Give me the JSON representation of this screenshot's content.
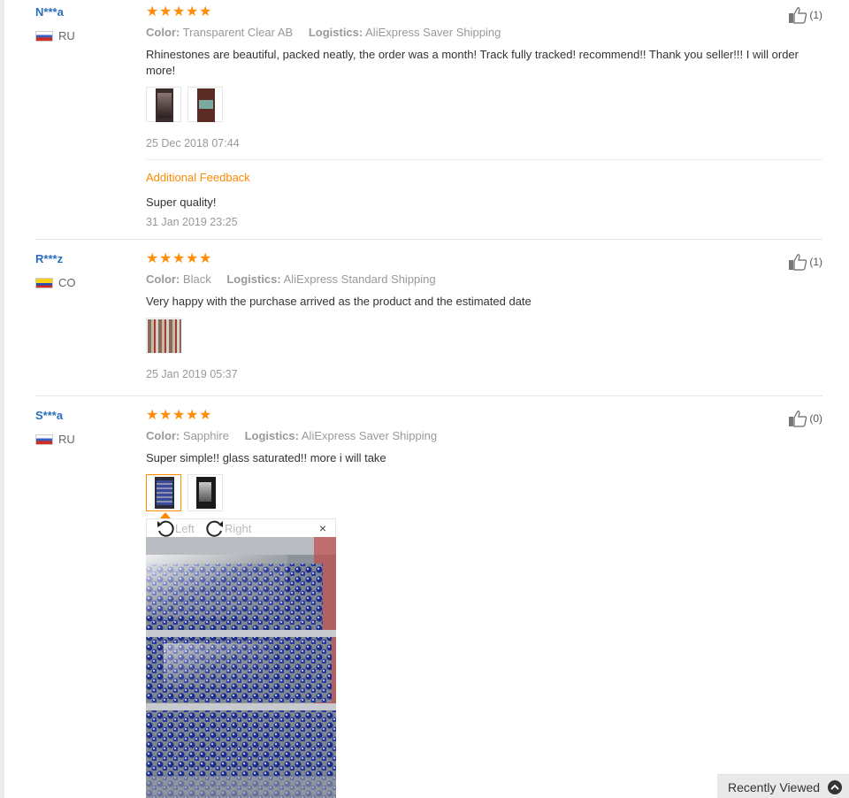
{
  "reviews": [
    {
      "user": "N***a",
      "country": "RU",
      "flag": "ru",
      "rating": 5,
      "color_label": "Color:",
      "color_value": "Transparent Clear AB",
      "logistics_label": "Logistics:",
      "logistics_value": "AliExpress Saver Shipping",
      "text": "Rhinestones are beautiful, packed neatly, the order was a month! Track fully tracked! recommend!! Thank you seller!!! I will order more!",
      "date": "25 Dec 2018 07:44",
      "additional_feedback_label": "Additional Feedback",
      "additional_text": "Super quality!",
      "additional_date": "31 Jan 2019 23:25",
      "helpful_count": "(1)"
    },
    {
      "user": "R***z",
      "country": "CO",
      "flag": "co",
      "rating": 5,
      "color_label": "Color:",
      "color_value": "Black",
      "logistics_label": "Logistics:",
      "logistics_value": "AliExpress Standard Shipping",
      "text": "Very happy with the purchase arrived as the product and the estimated date",
      "date": "25 Jan 2019 05:37",
      "helpful_count": "(1)"
    },
    {
      "user": "S***a",
      "country": "RU",
      "flag": "ru",
      "rating": 5,
      "color_label": "Color:",
      "color_value": "Sapphire",
      "logistics_label": "Logistics:",
      "logistics_value": "AliExpress Saver Shipping",
      "text": "Super simple!! glass saturated!! more i will take",
      "helpful_count": "(0)"
    }
  ],
  "viewer": {
    "rotate_left": "Left",
    "rotate_right": "Right",
    "close": "×"
  },
  "recently_viewed": "Recently Viewed",
  "colors": {
    "accent": "#ff8a00",
    "star": "#ff8d0a",
    "username": "#2a6ebb"
  }
}
